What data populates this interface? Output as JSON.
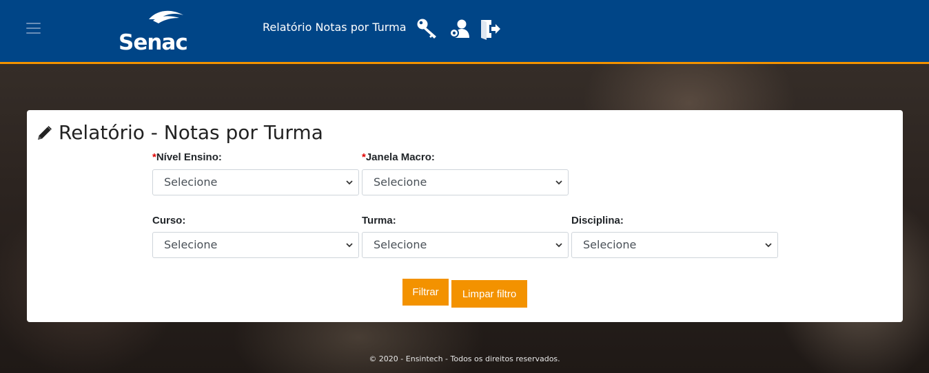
{
  "header": {
    "logo_text": "Senac",
    "title": "Relatório Notas por Turma",
    "icons": [
      "menu-icon",
      "key-icon",
      "user-settings-icon",
      "logout-icon"
    ]
  },
  "card": {
    "title": "Relatório - Notas por Turma",
    "fields": {
      "nivel_ensino": {
        "required_mark": "*",
        "label": "Nível Ensino:",
        "value": "Selecione"
      },
      "janela_macro": {
        "required_mark": "*",
        "label": "Janela Macro:",
        "value": "Selecione"
      },
      "curso": {
        "label": "Curso:",
        "value": "Selecione"
      },
      "turma": {
        "label": "Turma:",
        "value": "Selecione"
      },
      "disciplina": {
        "label": "Disciplina:",
        "value": "Selecione"
      }
    },
    "buttons": {
      "filter": "Filtrar",
      "clear": "Limpar filtro"
    }
  },
  "footer": {
    "text": "© 2020 - Ensintech - Todos os direitos reservados."
  },
  "colors": {
    "header_bg": "#004587",
    "accent": "#f39200",
    "required": "#e00000"
  }
}
